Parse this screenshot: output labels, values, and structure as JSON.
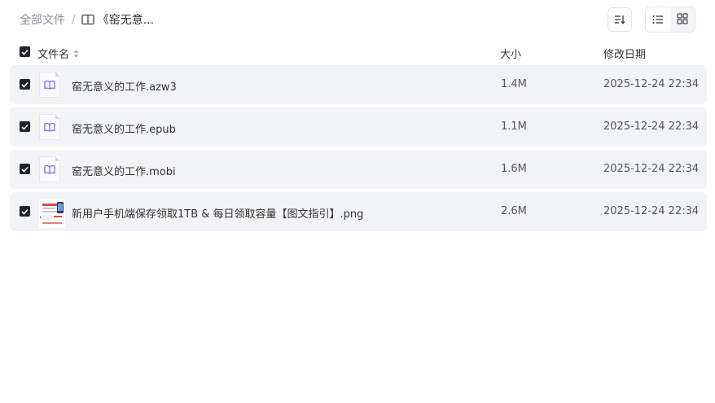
{
  "breadcrumb": {
    "root": "全部文件",
    "separator": "/",
    "current": "《窑无意...",
    "folder_icon": "book-icon"
  },
  "toolbar": {
    "sort_icon": "sort-icon",
    "list_view_icon": "list-view-icon",
    "grid_view_icon": "grid-view-icon"
  },
  "columns": {
    "name": "文件名",
    "size": "大小",
    "modified": "修改日期"
  },
  "files": [
    {
      "name": "窑无意义的工作.azw3",
      "size": "1.4M",
      "modified": "2025-12-24 22:34",
      "icon": "ebook-icon",
      "checked": true
    },
    {
      "name": "窑无意义的工作.epub",
      "size": "1.1M",
      "modified": "2025-12-24 22:34",
      "icon": "ebook-icon",
      "checked": true
    },
    {
      "name": "窑无意义的工作.mobi",
      "size": "1.6M",
      "modified": "2025-12-24 22:34",
      "icon": "ebook-icon",
      "checked": true
    },
    {
      "name": "新用户手机端保存领取1TB & 每日领取容量【图文指引】.png",
      "size": "2.6M",
      "modified": "2025-12-24 22:34",
      "icon": "image-thumbnail",
      "checked": true
    }
  ],
  "colors": {
    "row_bg": "#f2f3f5",
    "checkbox": "#1f2329",
    "ebook_accent": "#7b6fd6"
  }
}
